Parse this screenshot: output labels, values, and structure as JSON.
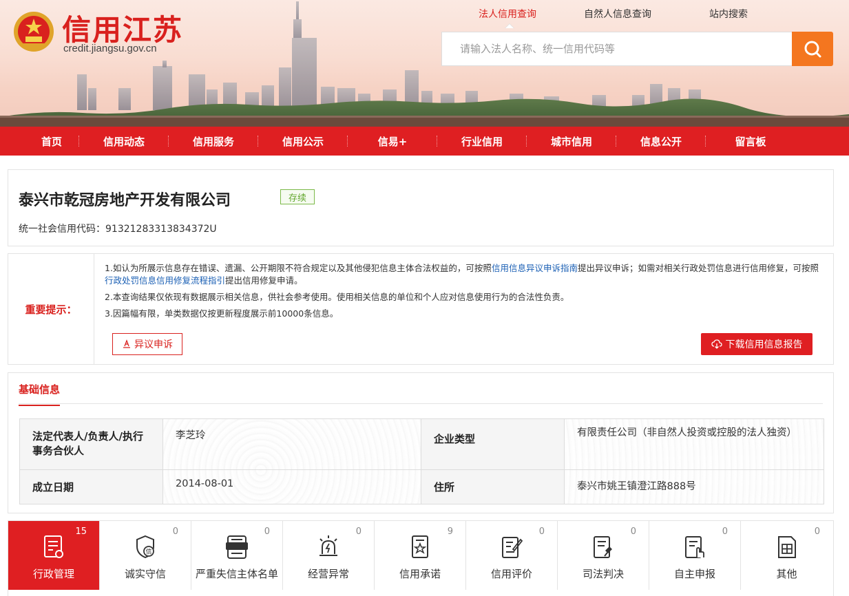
{
  "site": {
    "title": "信用江苏",
    "url": "credit.jiangsu.gov.cn"
  },
  "search": {
    "tabs": [
      "法人信用查询",
      "自然人信息查询",
      "站内搜索"
    ],
    "active_tab": 0,
    "placeholder": "请输入法人名称、统一信用代码等"
  },
  "nav": {
    "items": [
      "首页",
      "信用动态",
      "信用服务",
      "信用公示",
      "信易+",
      "行业信用",
      "城市信用",
      "信息公开",
      "留言板"
    ]
  },
  "company": {
    "name": "泰兴市乾冠房地产开发有限公司",
    "status": "存续",
    "credit_code_label": "统一社会信用代码：",
    "credit_code": "91321283313834372U"
  },
  "notice": {
    "label": "重要提示：",
    "line1_a": "1.如认为所展示信息存在错误、遗漏、公开期限不符合规定以及其他侵犯信息主体合法权益的，可按照",
    "line1_link1": "信用信息异议申诉指南",
    "line1_b": "提出异议申诉；如需对相关行政处罚信息进行信用修复，可按照",
    "line1_link2": "行政处罚信息信用修复流程指引",
    "line1_c": "提出信用修复申请。",
    "line2": "2.本查询结果仅依现有数据展示相关信息，供社会参考使用。使用相关信息的单位和个人应对信息使用行为的合法性负责。",
    "line3": "3.因篇幅有限，单类数据仅按更新程度展示前10000条信息。",
    "objection_label": "异议申诉",
    "download_label": "下载信用信息报告"
  },
  "basic_info": {
    "section_title": "基础信息",
    "rows": [
      {
        "k1": "法定代表人/负责人/执行事务合伙人",
        "v1": "李芝玲",
        "k2": "企业类型",
        "v2": "有限责任公司（非自然人投资或控股的法人独资）"
      },
      {
        "k1": "成立日期",
        "v1": "2014-08-01",
        "k2": "住所",
        "v2": "泰兴市姚王镇澄江路888号"
      }
    ]
  },
  "categories": [
    {
      "label": "行政管理",
      "count": "15",
      "icon": "admin-doc-icon"
    },
    {
      "label": "诚实守信",
      "count": "0",
      "icon": "shield-credit-icon"
    },
    {
      "label": "严重失信主体名单",
      "count": "0",
      "icon": "blacklist-icon"
    },
    {
      "label": "经营异常",
      "count": "0",
      "icon": "alarm-icon"
    },
    {
      "label": "信用承诺",
      "count": "9",
      "icon": "promise-icon"
    },
    {
      "label": "信用评价",
      "count": "0",
      "icon": "evaluation-icon"
    },
    {
      "label": "司法判决",
      "count": "0",
      "icon": "judgment-icon"
    },
    {
      "label": "自主申报",
      "count": "0",
      "icon": "self-report-icon"
    },
    {
      "label": "其他",
      "count": "0",
      "icon": "other-icon"
    }
  ],
  "colors": {
    "brand_red": "#df1f22",
    "search_orange": "#f4761f",
    "status_green": "#63a82e",
    "link_blue": "#1a5fb4"
  }
}
